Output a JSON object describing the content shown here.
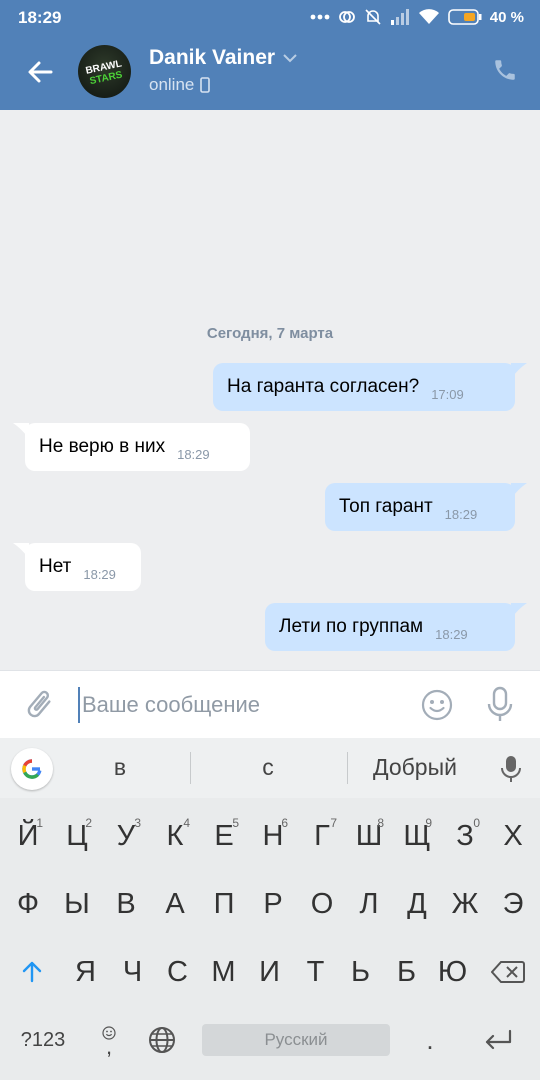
{
  "status_bar": {
    "time": "18:29",
    "battery_text": "40 %",
    "icons": [
      "dots-icon",
      "sync-icon",
      "mute-icon",
      "signal-icon",
      "wifi-icon",
      "battery-icon"
    ]
  },
  "header": {
    "back_icon": "arrow-left-icon",
    "avatar_text": [
      "BRAWL",
      "STARS"
    ],
    "contact_name": "Danik Vainer",
    "status": "online",
    "call_icon": "phone-icon",
    "accent_color": "#5181b8"
  },
  "chat": {
    "date_separator": "Сегодня, 7 марта",
    "messages": [
      {
        "direction": "out",
        "text": "На гаранта согласен?",
        "time": "17:09"
      },
      {
        "direction": "in",
        "text": "Не верю в них",
        "time": "18:29"
      },
      {
        "direction": "out",
        "text": "Топ гарант",
        "time": "18:29"
      },
      {
        "direction": "in",
        "text": "Нет",
        "time": "18:29"
      },
      {
        "direction": "out",
        "text": "Лети по группам",
        "time": "18:29"
      }
    ],
    "colors": {
      "outgoing_bubble": "#cce4ff",
      "incoming_bubble": "#ffffff"
    }
  },
  "composer": {
    "placeholder": "Ваше сообщение",
    "value": ""
  },
  "keyboard": {
    "suggestions": [
      "в",
      "с",
      "Добрый"
    ],
    "row1": [
      {
        "label": "Й",
        "hint": "1"
      },
      {
        "label": "Ц",
        "hint": "2"
      },
      {
        "label": "У",
        "hint": "3"
      },
      {
        "label": "К",
        "hint": "4"
      },
      {
        "label": "Е",
        "hint": "5"
      },
      {
        "label": "Н",
        "hint": "6"
      },
      {
        "label": "Г",
        "hint": "7"
      },
      {
        "label": "Ш",
        "hint": "8"
      },
      {
        "label": "Щ",
        "hint": "9"
      },
      {
        "label": "З",
        "hint": "0"
      },
      {
        "label": "Х",
        "hint": ""
      }
    ],
    "row2": [
      "Ф",
      "Ы",
      "В",
      "А",
      "П",
      "Р",
      "О",
      "Л",
      "Д",
      "Ж",
      "Э"
    ],
    "row3": [
      "Я",
      "Ч",
      "С",
      "М",
      "И",
      "Т",
      "Ь",
      "Б",
      "Ю"
    ],
    "symbols_label": "?123",
    "emoji_comma_label": ",",
    "space_label": "Русский",
    "period_label": "."
  }
}
